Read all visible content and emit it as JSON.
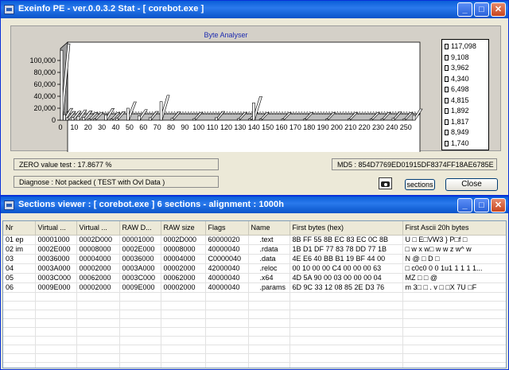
{
  "main_window": {
    "title": "Exeinfo PE - ver.0.0.3.2  Stat -  [ corebot.exe ]",
    "controls": {
      "minimize": "_",
      "maximize": "□",
      "close": "✕"
    }
  },
  "chart_data": {
    "type": "bar",
    "title": "Byte Analyser",
    "xlabel": "",
    "ylabel": "",
    "ylim": [
      0,
      120000
    ],
    "y_ticks": [
      "0",
      "20,000",
      "40,000",
      "60,000",
      "80,000",
      "100,000"
    ],
    "x_ticks": [
      "0",
      "10",
      "20",
      "30",
      "40",
      "50",
      "60",
      "70",
      "80",
      "90",
      "100",
      "110",
      "120",
      "130",
      "140",
      "150",
      "160",
      "170",
      "180",
      "190",
      "200",
      "210",
      "220",
      "230",
      "240",
      "250"
    ],
    "x": [
      0,
      2,
      4,
      8,
      12,
      16,
      20,
      24,
      32,
      36,
      40,
      48,
      56,
      64,
      72,
      80,
      96,
      112,
      128,
      136,
      139,
      144,
      160,
      176,
      192,
      208,
      224,
      232,
      240,
      248,
      255
    ],
    "values": [
      117098,
      9108,
      3962,
      4340,
      6498,
      4815,
      1892,
      1817,
      8949,
      1740,
      3200,
      20000,
      7000,
      4000,
      31000,
      3000,
      2500,
      4000,
      2500,
      2000,
      29000,
      1900,
      1800,
      1800,
      1800,
      1800,
      1800,
      2200,
      3000,
      2200,
      8000
    ],
    "legend": [
      "117,098",
      "9,108",
      "3,962",
      "4,340",
      "6,498",
      "4,815",
      "1,892",
      "1,817",
      "8,949",
      "1,740"
    ],
    "grid": false,
    "legend_placement": "right"
  },
  "status": {
    "zero_test": "ZERO value test : 17.8677 %",
    "md5": "MD5 : 854D7769ED01915DF8374FF18AE6785E",
    "diagnose": "Diagnose :  Not packed  ( TEST with Ovl Data )"
  },
  "buttons": {
    "sections": "sections",
    "close": "Close"
  },
  "sections_window": {
    "title": "Sections viewer : [ corebot.exe ] 6 sections - alignment : 1000h",
    "columns": [
      "Nr",
      "Virtual ...",
      "Virtual ...",
      "RAW D...",
      "RAW size",
      "Flags",
      "Name",
      "First bytes (hex)",
      "First Ascii 20h bytes"
    ],
    "rows": [
      [
        "01 ep",
        "00001000",
        "0002D000",
        "00001000",
        "0002D000",
        "60000020",
        ".text",
        "8B FF 55 8B EC 83 EC 0C 8B",
        "U  □ E□VW3 } P□f □"
      ],
      [
        "02 im",
        "0002E000",
        "00008000",
        "0002E000",
        "00008000",
        "40000040",
        ".rdata",
        "1B D1 DF 77 83 78 DD 77 1B",
        "□  w x w□ w  w z w^  w"
      ],
      [
        "03",
        "00036000",
        "00004000",
        "00036000",
        "00004000",
        "C0000040",
        ".data",
        "4E E6 40 BB B1 19 BF 44 00",
        "N @  □ D          □"
      ],
      [
        "04",
        "0003A000",
        "00002000",
        "0003A000",
        "00002000",
        "42000040",
        ".reloc",
        "00 10 00 00 C4 00 00 00 63",
        "□    c0c0 0 0 1u1 1 1 1 1..."
      ],
      [
        "05",
        "0003C000",
        "00062000",
        "0003C000",
        "00062000",
        "40000040",
        ".x64",
        "4D 5A 90 00 03 00 00 00 04",
        "MZ  □   □        @"
      ],
      [
        "06",
        "0009E000",
        "00002000",
        "0009E000",
        "00002000",
        "40000040",
        ".params",
        "6D 9C 33 12 08 85 2E D3 76",
        "m 3□ □ . v  □ □X  7U □F"
      ]
    ]
  },
  "colors": {
    "titlebar": "#0a5ed8",
    "chart_bar": "#ffffff",
    "chart_axis": "#000000",
    "window_bg": "#ece9d8"
  }
}
